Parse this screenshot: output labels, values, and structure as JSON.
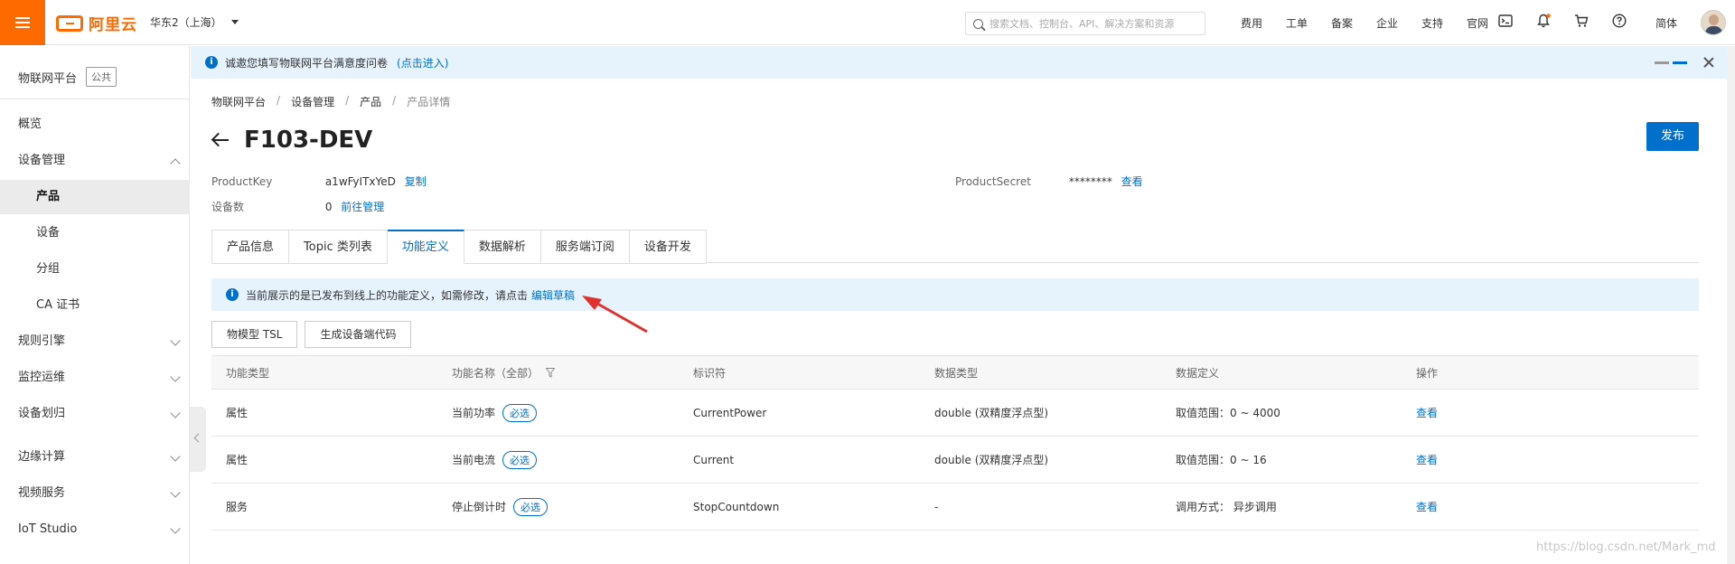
{
  "topbar": {
    "logo_text": "阿里云",
    "region": "华东2（上海）",
    "search_placeholder": "搜索文档、控制台、API、解决方案和资源",
    "links": [
      "费用",
      "工单",
      "备案",
      "企业",
      "支持",
      "官网"
    ],
    "lang": "简体"
  },
  "sidebar": {
    "title": "物联网平台",
    "tag": "公共",
    "items": [
      {
        "label": "概览"
      },
      {
        "label": "设备管理"
      },
      {
        "label": "产品"
      },
      {
        "label": "设备"
      },
      {
        "label": "分组"
      },
      {
        "label": "CA 证书"
      },
      {
        "label": "规则引擎"
      },
      {
        "label": "监控运维"
      },
      {
        "label": "设备划归"
      },
      {
        "label": "边缘计算"
      },
      {
        "label": "视频服务"
      },
      {
        "label": "IoT Studio"
      }
    ]
  },
  "notice": {
    "text": "诚邀您填写物联网平台满意度问卷",
    "link": "(点击进入)"
  },
  "breadcrumb": [
    "物联网平台",
    "设备管理",
    "产品",
    "产品详情"
  ],
  "page": {
    "title": "F103-DEV",
    "publish": "发布",
    "product_key_label": "ProductKey",
    "product_key": "a1wFyITxYeD",
    "copy": "复制",
    "product_secret_label": "ProductSecret",
    "product_secret": "********",
    "view": "查看",
    "device_count_label": "设备数",
    "device_count": "0",
    "manage": "前往管理"
  },
  "tabs": [
    "产品信息",
    "Topic 类列表",
    "功能定义",
    "数据解析",
    "服务端订阅",
    "设备开发"
  ],
  "hint": {
    "text": "当前展示的是已发布到线上的功能定义，如需修改，请点击",
    "link": "编辑草稿"
  },
  "buttons": {
    "tsl": "物模型 TSL",
    "gen_code": "生成设备端代码"
  },
  "table": {
    "headers": [
      "功能类型",
      "功能名称（全部）",
      "标识符",
      "数据类型",
      "数据定义",
      "操作"
    ],
    "rows": [
      {
        "type": "属性",
        "name": "当前功率",
        "badge": "必选",
        "id": "CurrentPower",
        "dtype": "double (双精度浮点型)",
        "def": "取值范围：0 ~ 4000",
        "op": "查看"
      },
      {
        "type": "属性",
        "name": "当前电流",
        "badge": "必选",
        "id": "Current",
        "dtype": "double (双精度浮点型)",
        "def": "取值范围：0 ~ 16",
        "op": "查看"
      },
      {
        "type": "服务",
        "name": "停止倒计时",
        "badge": "必选",
        "id": "StopCountdown",
        "dtype": "-",
        "def": "调用方式：  异步调用",
        "op": "查看"
      }
    ]
  },
  "watermark": "https://blog.csdn.net/Mark_md"
}
